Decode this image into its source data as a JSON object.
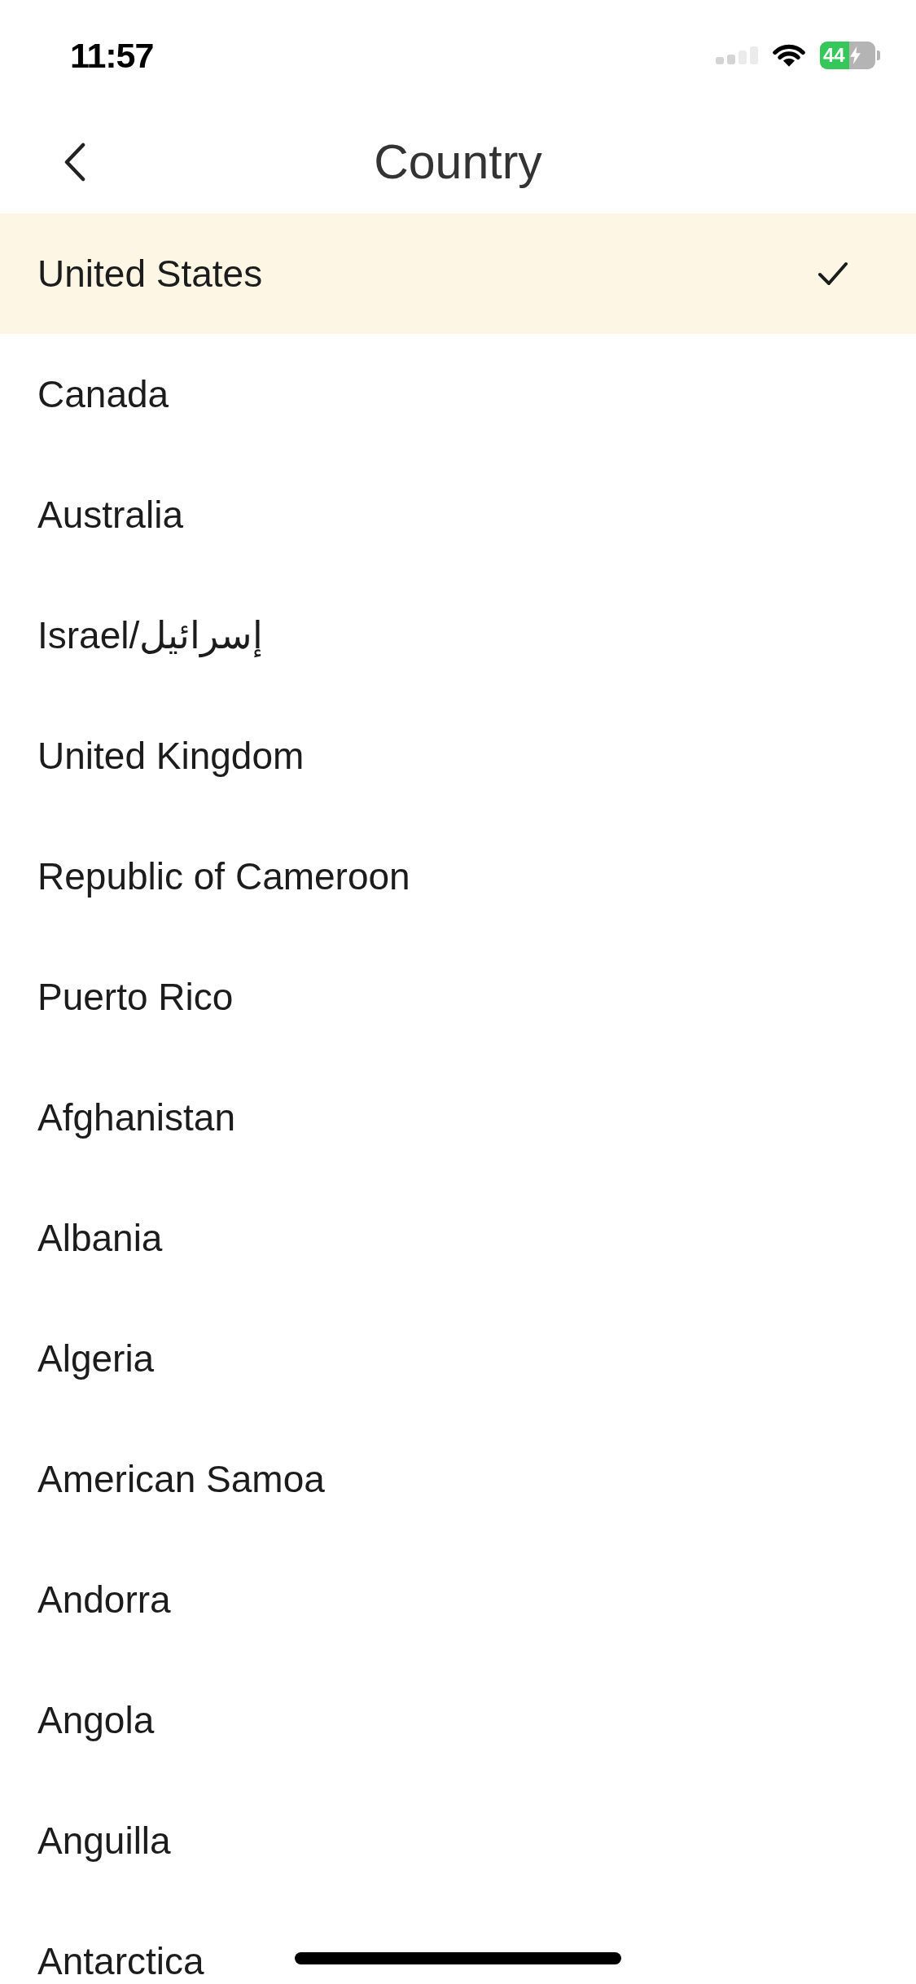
{
  "status_bar": {
    "time": "11:57",
    "battery": "44"
  },
  "header": {
    "title": "Country"
  },
  "countries": [
    {
      "name": "United States",
      "selected": true
    },
    {
      "name": "Canada",
      "selected": false
    },
    {
      "name": "Australia",
      "selected": false
    },
    {
      "name": "Israel/إسرائيل",
      "selected": false
    },
    {
      "name": "United Kingdom",
      "selected": false
    },
    {
      "name": "Republic of Cameroon",
      "selected": false
    },
    {
      "name": "Puerto Rico",
      "selected": false
    },
    {
      "name": "Afghanistan",
      "selected": false
    },
    {
      "name": "Albania",
      "selected": false
    },
    {
      "name": "Algeria",
      "selected": false
    },
    {
      "name": "American Samoa",
      "selected": false
    },
    {
      "name": "Andorra",
      "selected": false
    },
    {
      "name": "Angola",
      "selected": false
    },
    {
      "name": "Anguilla",
      "selected": false
    },
    {
      "name": "Antarctica",
      "selected": false
    }
  ]
}
